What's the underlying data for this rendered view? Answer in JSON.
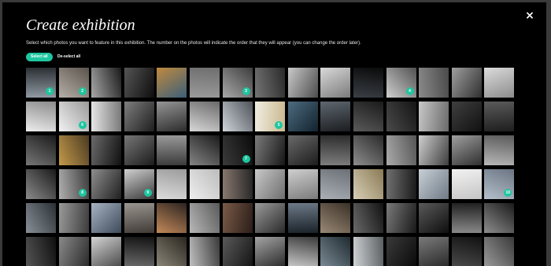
{
  "dialog": {
    "title": "Create exhibition",
    "instructions": "Select which photos you want to feature in this exhibition. The number on the photos will indicate the order that they will appear (you can change the order later).",
    "close_icon": "×",
    "select_all_label": "Select all",
    "deselect_all_label": "De-select all",
    "accent_color": "#1ec6a0"
  },
  "photos": [
    {
      "selected": 1,
      "colors": [
        "#8f9aa3",
        "#2b2f33"
      ]
    },
    {
      "selected": 2,
      "colors": [
        "#b7b0a8",
        "#5a534c"
      ]
    },
    {
      "colors": [
        "#a8a8a8",
        "#1a1a1a"
      ]
    },
    {
      "colors": [
        "#555",
        "#0d0d0d"
      ]
    },
    {
      "colors": [
        "#c08a3e",
        "#3b5f7a"
      ]
    },
    {
      "colors": [
        "#9b9b9b",
        "#6e6e6e"
      ]
    },
    {
      "selected": 3,
      "colors": [
        "#a9a9a9",
        "#3d3d3d"
      ]
    },
    {
      "colors": [
        "#747474",
        "#2a2a2a"
      ]
    },
    {
      "colors": [
        "#c9c9c9",
        "#4d4d4d"
      ]
    },
    {
      "colors": [
        "#d9d9d9",
        "#7b7b7b"
      ]
    },
    {
      "colors": [
        "#3a3f46",
        "#0a0a0a"
      ]
    },
    {
      "selected": 4,
      "colors": [
        "#cfcfcf",
        "#515151"
      ]
    },
    {
      "colors": [
        "#8a8a8a",
        "#4a4a4a"
      ]
    },
    {
      "colors": [
        "#9f9f9f",
        "#2f2f2f"
      ]
    },
    {
      "colors": [
        "#dcdcdc",
        "#8c8c8c"
      ]
    },
    {
      "colors": [
        "#ededed",
        "#8a8a8a"
      ]
    },
    {
      "selected": 6,
      "colors": [
        "#f2f2f2",
        "#9a9a9a"
      ]
    },
    {
      "colors": [
        "#e6e6e6",
        "#7a7a7a"
      ]
    },
    {
      "colors": [
        "#7e7e7e",
        "#1e1e1e"
      ]
    },
    {
      "colors": [
        "#969696",
        "#2c2c2c"
      ]
    },
    {
      "colors": [
        "#d7d7d7",
        "#6a6a6a"
      ]
    },
    {
      "colors": [
        "#cfd5da",
        "#4d5358"
      ]
    },
    {
      "selected": 5,
      "colors": [
        "#f1ede2",
        "#c9b98f"
      ]
    },
    {
      "colors": [
        "#4d6c80",
        "#12222d"
      ]
    },
    {
      "colors": [
        "#5f6770",
        "#1a1d20"
      ]
    },
    {
      "colors": [
        "#5a5a5a",
        "#1a1a1a"
      ]
    },
    {
      "colors": [
        "#4a4a4a",
        "#141414"
      ]
    },
    {
      "colors": [
        "#c8c8c8",
        "#6a6a6a"
      ]
    },
    {
      "colors": [
        "#3f3f3f",
        "#111"
      ]
    },
    {
      "colors": [
        "#5b5b5b",
        "#1d1d1d"
      ]
    },
    {
      "colors": [
        "#777",
        "#1a1a1a"
      ]
    },
    {
      "colors": [
        "#c49a4a",
        "#4a3a22"
      ]
    },
    {
      "colors": [
        "#6a6a6a",
        "#101010"
      ]
    },
    {
      "colors": [
        "#777",
        "#1b1b1b"
      ]
    },
    {
      "colors": [
        "#9a9a9a",
        "#3a3a3a"
      ]
    },
    {
      "colors": [
        "#858585",
        "#1a1a1a"
      ]
    },
    {
      "selected": 7,
      "colors": [
        "#3a3a3a",
        "#0b0b0b"
      ]
    },
    {
      "colors": [
        "#7b7b7b",
        "#161616"
      ]
    },
    {
      "colors": [
        "#6a6a6a",
        "#1c1c1c"
      ]
    },
    {
      "colors": [
        "#7e7e7e",
        "#2c2c2c"
      ]
    },
    {
      "colors": [
        "#8d8d8d",
        "#2a2a2a"
      ]
    },
    {
      "colors": [
        "#ababab",
        "#555"
      ]
    },
    {
      "colors": [
        "#cfcfcf",
        "#3e3e3e"
      ]
    },
    {
      "colors": [
        "#a0a0a0",
        "#2f2f2f"
      ]
    },
    {
      "colors": [
        "#b8b8b8",
        "#5a5a5a"
      ]
    },
    {
      "colors": [
        "#8b8b8b",
        "#1a1a1a"
      ]
    },
    {
      "selected": 8,
      "colors": [
        "#b0b0b0",
        "#3c3c3c"
      ]
    },
    {
      "colors": [
        "#8e8e8e",
        "#202020"
      ]
    },
    {
      "selected": 9,
      "colors": [
        "#d0d0d0",
        "#3a3a3a"
      ]
    },
    {
      "colors": [
        "#dcdcdc",
        "#9b9b9b"
      ]
    },
    {
      "colors": [
        "#eeeeee",
        "#bcbcbc"
      ]
    },
    {
      "colors": [
        "#8a7a70",
        "#262626"
      ]
    },
    {
      "colors": [
        "#c8c8c8",
        "#6e6e6e"
      ]
    },
    {
      "colors": [
        "#cfcfcf",
        "#7a7a7a"
      ]
    },
    {
      "colors": [
        "#aab0b5",
        "#6a7075"
      ]
    },
    {
      "colors": [
        "#d8cfb6",
        "#8a7a55"
      ]
    },
    {
      "colors": [
        "#707070",
        "#1a1a1a"
      ]
    },
    {
      "colors": [
        "#c8cfd6",
        "#6f7a85"
      ]
    },
    {
      "colors": [
        "#f2f2f2",
        "#c5c5c5"
      ]
    },
    {
      "selected": 10,
      "colors": [
        "#b5c0cc",
        "#6a7482"
      ]
    },
    {
      "colors": [
        "#8a9097",
        "#2a2f36"
      ]
    },
    {
      "colors": [
        "#9a9a9a",
        "#3c3c3c"
      ]
    },
    {
      "colors": [
        "#a8b4c2",
        "#3d4a5a"
      ]
    },
    {
      "colors": [
        "#9a9690",
        "#3f3a35"
      ]
    },
    {
      "colors": [
        "#c48a5a",
        "#2a2320"
      ]
    },
    {
      "colors": [
        "#b8b8b8",
        "#5a5a5a"
      ]
    },
    {
      "colors": [
        "#7a5a48",
        "#2a1d18"
      ]
    },
    {
      "colors": [
        "#9a9a9a",
        "#2a2a2a"
      ]
    },
    {
      "colors": [
        "#6d7a88",
        "#1a2128"
      ]
    },
    {
      "colors": [
        "#9a8a76",
        "#3a3026"
      ]
    },
    {
      "colors": [
        "#6a6a6a",
        "#121212"
      ]
    },
    {
      "colors": [
        "#7a7a7a",
        "#181818"
      ]
    },
    {
      "colors": [
        "#5a5a5a",
        "#0e0e0e"
      ]
    },
    {
      "colors": [
        "#8a8a8a",
        "#202020"
      ]
    },
    {
      "colors": [
        "#8d8d8d",
        "#1a1a1a"
      ]
    },
    {
      "colors": [
        "#555",
        "#0f0f0f"
      ]
    },
    {
      "colors": [
        "#8a8a8a",
        "#2a2a2a"
      ]
    },
    {
      "colors": [
        "#d5d5d5",
        "#4a4a4a"
      ]
    },
    {
      "colors": [
        "#6a6a6a",
        "#121212"
      ]
    },
    {
      "colors": [
        "#8a8678",
        "#2a2620"
      ]
    },
    {
      "colors": [
        "#bfbfbf",
        "#3a3a3a"
      ]
    },
    {
      "colors": [
        "#5a5a5a",
        "#141414"
      ]
    },
    {
      "colors": [
        "#a5a5a5",
        "#2a2a2a"
      ]
    },
    {
      "colors": [
        "#c8c8c8",
        "#3a3a3a"
      ]
    },
    {
      "colors": [
        "#7a8a94",
        "#1f2a30"
      ]
    },
    {
      "colors": [
        "#cfd3d6",
        "#5a5f62"
      ]
    },
    {
      "colors": [
        "#3a3a3a",
        "#0a0a0a"
      ]
    },
    {
      "colors": [
        "#7a7a7a",
        "#2a2a2a"
      ]
    },
    {
      "colors": [
        "#4a4a4a",
        "#111"
      ]
    },
    {
      "colors": [
        "#9a9a9a",
        "#3a3a3a"
      ]
    }
  ]
}
